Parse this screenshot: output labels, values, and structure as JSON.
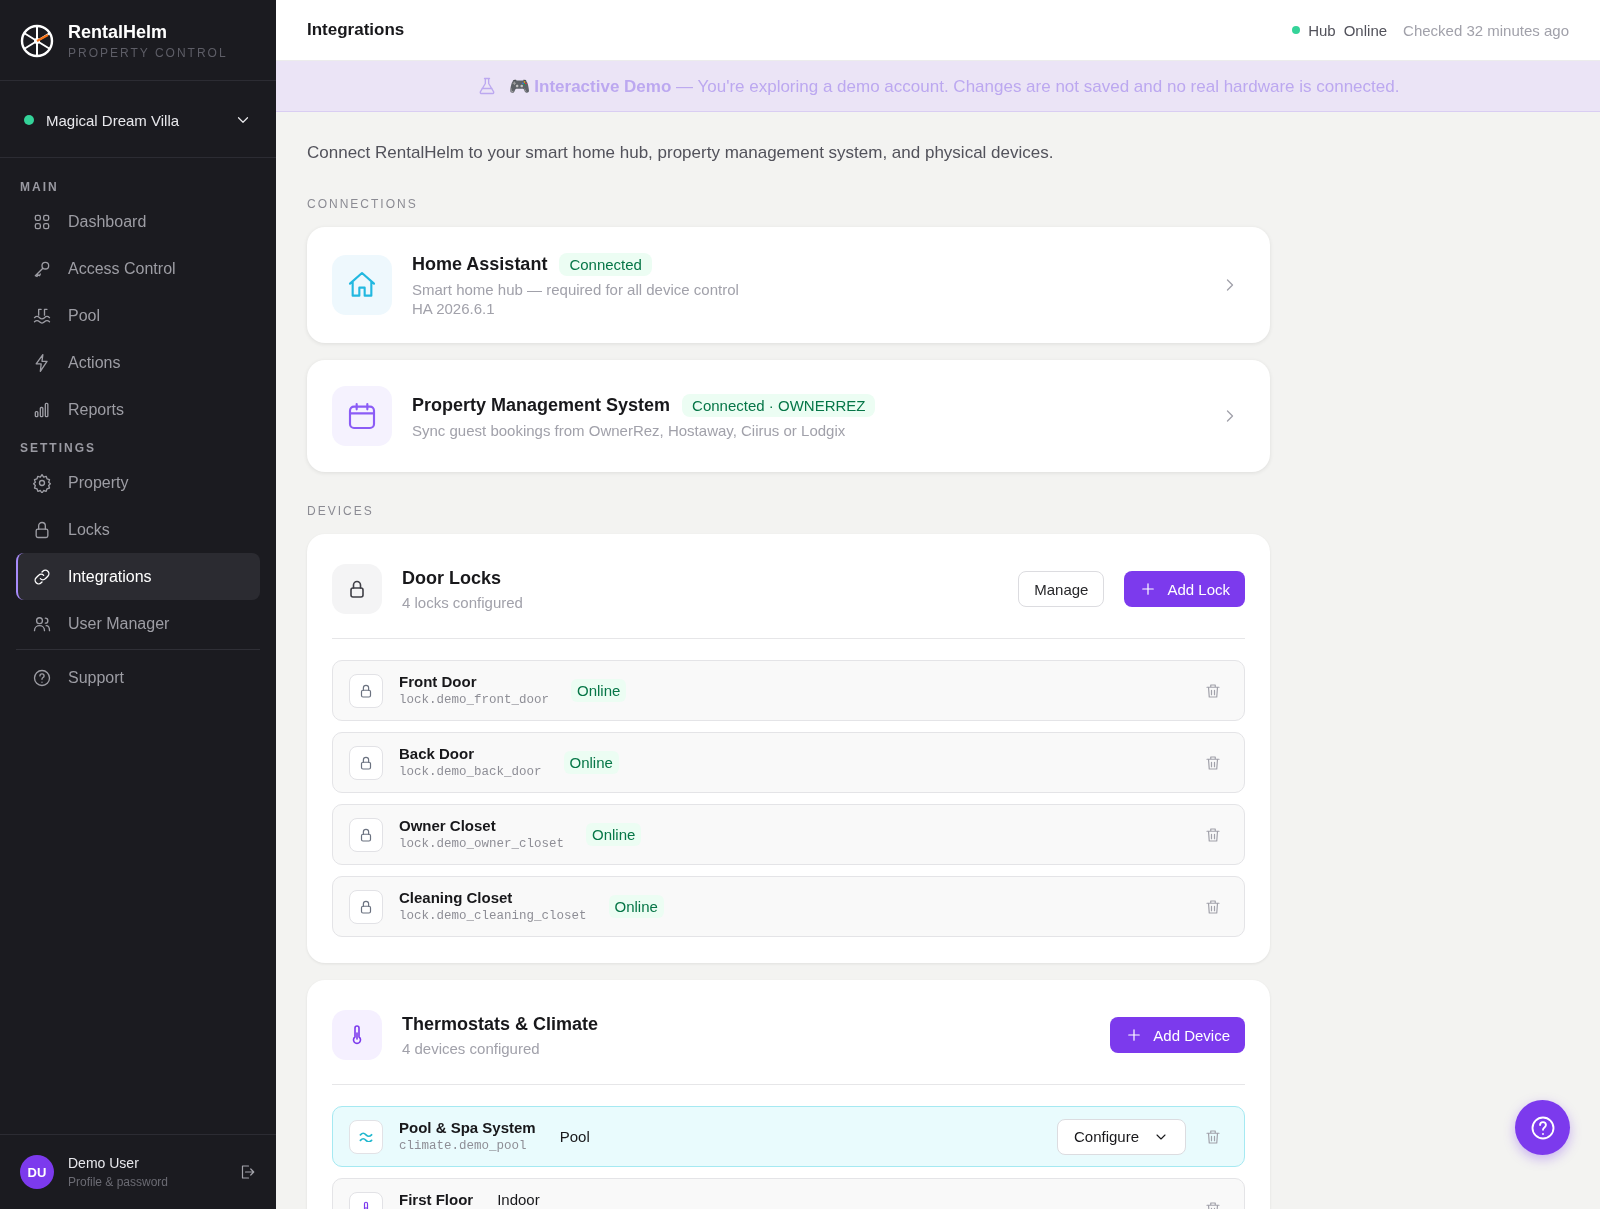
{
  "brand": {
    "name": "RentalHelm",
    "tagline": "PROPERTY CONTROL"
  },
  "property": {
    "name": "Magical Dream Villa",
    "color": "#34d399"
  },
  "nav": [
    {
      "heading": "MAIN",
      "items": [
        {
          "label": "Dashboard",
          "selected": false
        },
        {
          "label": "Access Control",
          "selected": false
        },
        {
          "label": "Pool",
          "selected": false
        },
        {
          "label": "Actions",
          "selected": false
        },
        {
          "label": "Reports",
          "selected": false
        }
      ]
    },
    {
      "heading": "SETTINGS",
      "items": [
        {
          "label": "Property",
          "selected": false
        },
        {
          "label": "Locks",
          "selected": false
        },
        {
          "label": "Integrations",
          "selected": true
        },
        {
          "label": "User Manager",
          "selected": false
        }
      ]
    },
    {
      "items": [
        {
          "label": "Support",
          "selected": false
        }
      ]
    }
  ],
  "user": {
    "initials": "DU",
    "name": "Demo User",
    "subtitle": "Profile & password"
  },
  "header": {
    "title": "Integrations",
    "hub_label": "Hub",
    "hub_status": "Online",
    "checked": "Checked 32 minutes ago"
  },
  "banner": {
    "emoji": "🎮",
    "title": "Interactive Demo",
    "message": "— You're exploring a demo account. Changes are not saved and no real hardware is connected."
  },
  "intro": "Connect RentalHelm to your smart home hub, property management system, and physical devices.",
  "connections_heading": "CONNECTIONS",
  "connections": [
    {
      "kind": "home",
      "name": "Home Assistant",
      "status": "Connected",
      "description": "Smart home hub — required for all device control",
      "version": "HA 2026.6.1"
    },
    {
      "kind": "calendar",
      "name": "Property Management System",
      "status": "Connected · OWNERREZ",
      "description": "Sync guest bookings from OwnerRez, Hostaway, Ciirus or Lodgix"
    }
  ],
  "devices_heading": "DEVICES",
  "device_groups": [
    {
      "kind": "locks",
      "title": "Door Locks",
      "subtitle": "4 locks configured",
      "manage": "Manage",
      "add": "Add Lock",
      "rows": [
        {
          "kind": "lock",
          "name": "Front Door",
          "entity": "lock.demo_front_door",
          "status": "Online",
          "selected": false
        },
        {
          "kind": "lock",
          "name": "Back Door",
          "entity": "lock.demo_back_door",
          "status": "Online",
          "selected": false
        },
        {
          "kind": "lock",
          "name": "Owner Closet",
          "entity": "lock.demo_owner_closet",
          "status": "Online",
          "selected": false
        },
        {
          "kind": "lock",
          "name": "Cleaning Closet",
          "entity": "lock.demo_cleaning_closet",
          "status": "Online",
          "selected": false
        }
      ]
    },
    {
      "kind": "climate",
      "title": "Thermostats & Climate",
      "subtitle": "4 devices configured",
      "add": "Add Device",
      "rows": [
        {
          "kind": "pool",
          "name": "Pool & Spa System",
          "entity": "climate.demo_pool",
          "zone": "Pool",
          "configure": "Configure",
          "selected": true
        },
        {
          "kind": "thermostat",
          "name": "First Floor",
          "zone": "Indoor",
          "selected": false
        }
      ]
    }
  ]
}
